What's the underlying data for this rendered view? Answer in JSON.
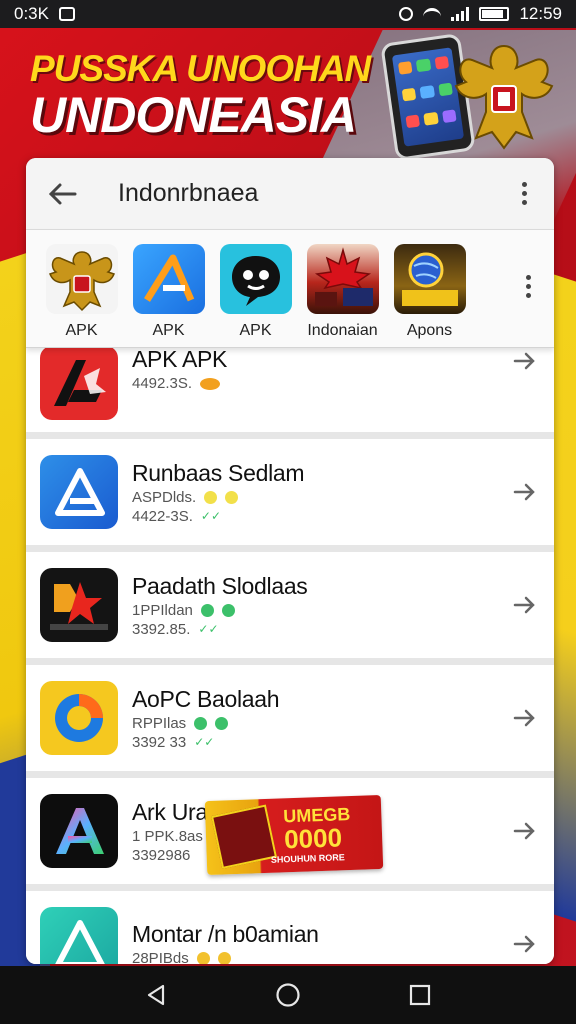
{
  "status_bar": {
    "time_left": "0:3K",
    "time_right": "12:59"
  },
  "banner": {
    "line1": "PUSSKA UNOOHAN",
    "line2": "UNDONEASIA"
  },
  "toolbar": {
    "title": "Indonrbnaea",
    "back_icon": "arrow-left-icon",
    "menu_icon": "more-vert-icon"
  },
  "featured": [
    {
      "label": "APK",
      "icon": "garuda-emblem-icon"
    },
    {
      "label": "APK",
      "icon": "triangle-a-logo-icon"
    },
    {
      "label": "APK",
      "icon": "chat-bubble-face-icon"
    },
    {
      "label": "Indonaian",
      "icon": "maple-leaf-game-icon"
    },
    {
      "label": "Apons",
      "icon": "globe-badge-icon"
    }
  ],
  "apps": [
    {
      "name": "APK APK",
      "line1": "4492.3S.",
      "line2": "",
      "icon": "red-a-logo-icon"
    },
    {
      "name": "Runbaas Sedlam",
      "line1": "ASPDlds.",
      "line2": "4422-3S.",
      "icon": "blue-triangle-logo-icon"
    },
    {
      "name": "Paadath Slodlaas",
      "line1": "1PPIldan",
      "line2": "3392.85.",
      "icon": "black-star-logo-icon"
    },
    {
      "name": "AoPC Baolaah",
      "line1": "RPPIlas",
      "line2": "3392 33",
      "icon": "yellow-swirl-logo-icon"
    },
    {
      "name": "Ark Ura",
      "line1": "1 PPK.8as",
      "line2": "3392986",
      "icon": "gradient-a-logo-icon"
    },
    {
      "name": "Montar /n b0amian",
      "line1": "28PIBds",
      "line2": "",
      "icon": "teal-triangle-logo-icon"
    }
  ],
  "promo": {
    "top": "UMEGB",
    "number": "0000",
    "bottom": "SHOUHUN RORE"
  },
  "colors": {
    "brand_red": "#d8121b",
    "flag_yellow": "#f3d21b",
    "flag_blue": "#213a9a",
    "accent_green": "#3cc06a",
    "badge_yellow": "#f2c12e"
  },
  "nav": {
    "back": "back-triangle-icon",
    "home": "home-circle-icon",
    "recents": "recents-square-icon"
  }
}
